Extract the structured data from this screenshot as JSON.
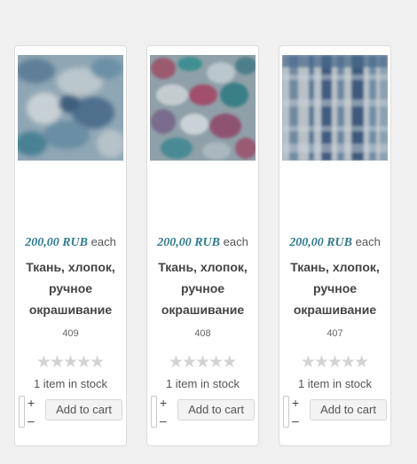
{
  "products": [
    {
      "image_icon": "fabric-photo",
      "price": "200,00 RUB",
      "unit": "each",
      "title": "Ткань, хлопок, ручное окрашивание",
      "sku": "409",
      "rating": 0,
      "stock": "1 item in stock",
      "qty_plus": "+",
      "qty_minus": "–",
      "button": "Add to cart"
    },
    {
      "image_icon": "fabric-photo",
      "price": "200,00 RUB",
      "unit": "each",
      "title": "Ткань, хлопок, ручное окрашивание",
      "sku": "408",
      "rating": 0,
      "stock": "1 item in stock",
      "qty_plus": "+",
      "qty_minus": "–",
      "button": "Add to cart"
    },
    {
      "image_icon": "fabric-photo",
      "price": "200,00 RUB",
      "unit": "each",
      "title": "Ткань, хлопок, ручное окрашивание",
      "sku": "407",
      "rating": 0,
      "stock": "1 item in stock",
      "qty_plus": "+",
      "qty_minus": "–",
      "button": "Add to cart"
    }
  ],
  "colors": {
    "price": "#2f7c8f",
    "star_empty": "#d3d3d3",
    "card_bg": "#ffffff",
    "page_bg": "#f0f0f0"
  }
}
